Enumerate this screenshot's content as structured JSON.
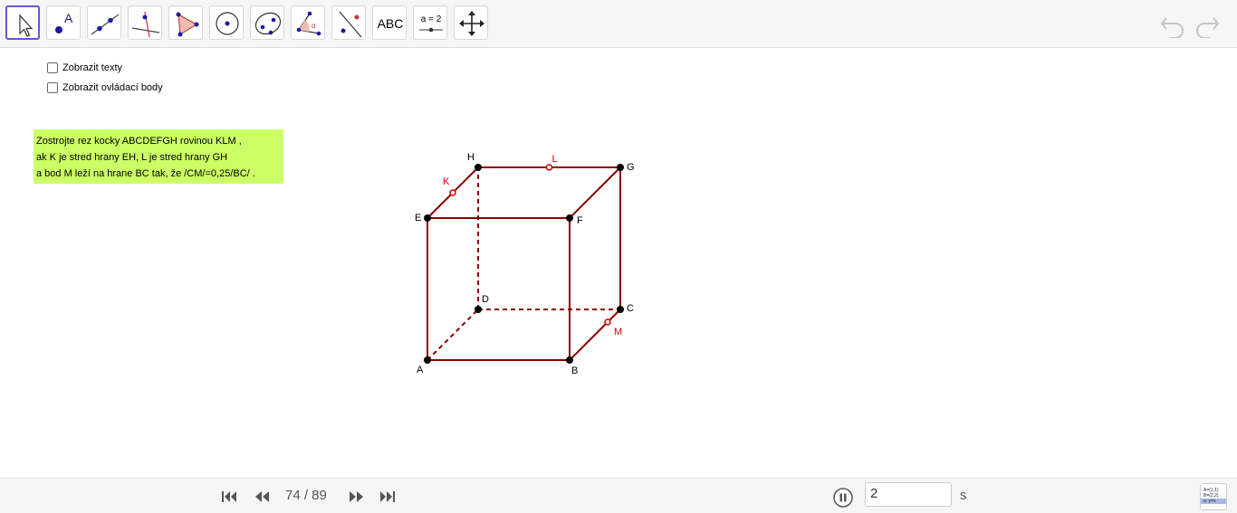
{
  "toolbar": {
    "tools": [
      {
        "name": "move-tool",
        "icon": "cursor-arrow-icon"
      },
      {
        "name": "point-tool",
        "icon": "point-icon",
        "label": "A"
      },
      {
        "name": "line-tool",
        "icon": "line-icon"
      },
      {
        "name": "perpendicular-line-tool",
        "icon": "perpendicular-icon"
      },
      {
        "name": "polygon-tool",
        "icon": "polygon-icon"
      },
      {
        "name": "circle-tool",
        "icon": "circle-icon"
      },
      {
        "name": "ellipse-tool",
        "icon": "ellipse-icon"
      },
      {
        "name": "angle-tool",
        "icon": "angle-icon",
        "label": "α"
      },
      {
        "name": "reflect-tool",
        "icon": "reflect-icon"
      },
      {
        "name": "text-tool",
        "icon": "text-icon",
        "label": "ABC"
      },
      {
        "name": "slider-tool",
        "icon": "slider-icon",
        "label": "a = 2"
      },
      {
        "name": "move-view-tool",
        "icon": "move-arrows-icon"
      }
    ],
    "undo_icon": "undo-icon",
    "redo_icon": "redo-icon"
  },
  "checkboxes": [
    {
      "label": "Zobrazit texty",
      "checked": false
    },
    {
      "label": "Zobrazit ovládací body",
      "checked": false
    }
  ],
  "task_text": {
    "line1": "Zostrojte rez kocky ABCDEFGH rovinou KLM ,",
    "line2": "ak K je stred hrany EH, L je stred hrany GH",
    "line3": "a bod M leží na hrane BC tak, že /CM/=0,25/BC/ ."
  },
  "figure": {
    "vertex_labels": {
      "A": "A",
      "B": "B",
      "C": "C",
      "D": "D",
      "E": "E",
      "F": "F",
      "G": "G",
      "H": "H"
    },
    "section_labels": {
      "K": "K",
      "L": "L",
      "M": "M"
    },
    "edge_color": "#8b0000",
    "section_point_color": "#cc0000"
  },
  "playback": {
    "counter": "74 / 89",
    "speed": "2",
    "unit": "s",
    "nav_icons": [
      "first-step-icon",
      "previous-step-icon",
      "next-step-icon",
      "last-step-icon"
    ],
    "pause_icon": "pause-icon"
  },
  "algebra_button": {
    "icon": "algebra-view-icon",
    "lines": [
      "A=(1,1)",
      "B=(2,2)",
      "a: y=x"
    ]
  }
}
